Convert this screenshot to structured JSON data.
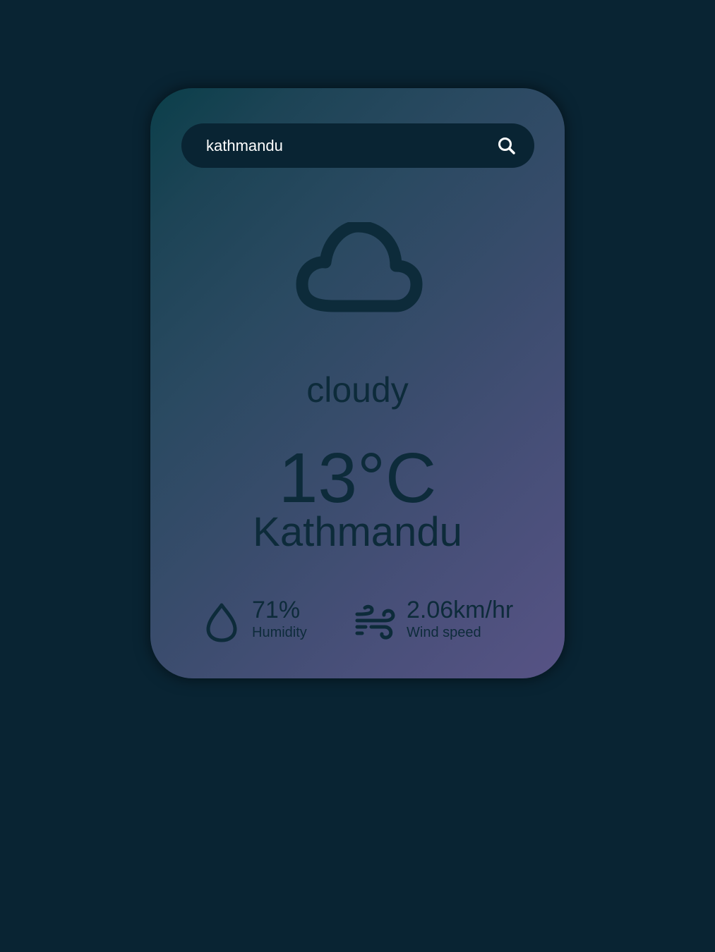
{
  "search": {
    "value": "kathmandu",
    "icon": "search-icon"
  },
  "weather": {
    "icon": "cloud-icon",
    "condition": "cloudy",
    "temperature": "13°C",
    "city": "Kathmandu"
  },
  "stats": {
    "humidity": {
      "icon": "droplet-icon",
      "value": "71%",
      "label": "Humidity"
    },
    "wind": {
      "icon": "wind-icon",
      "value": "2.06km/hr",
      "label": "Wind speed"
    }
  },
  "colors": {
    "background": "#092433",
    "card_gradient_start": "#0b3f4a",
    "card_gradient_end": "#575385",
    "text": "#0d2b3a",
    "search_text": "#ffffff"
  }
}
